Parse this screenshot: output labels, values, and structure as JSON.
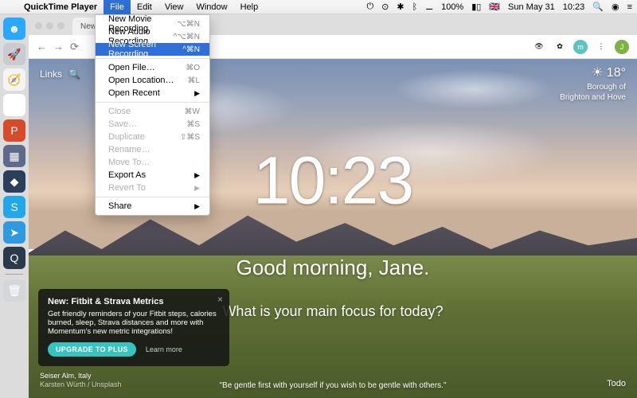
{
  "menubar": {
    "app_name": "QuickTime Player",
    "items": [
      "File",
      "Edit",
      "View",
      "Window",
      "Help"
    ],
    "active_index": 0,
    "right": {
      "battery": "100%",
      "date": "Sun May 31",
      "time": "10:23"
    }
  },
  "file_menu": {
    "groups": [
      [
        {
          "label": "New Movie Recording",
          "shortcut": "⌥⌘N"
        },
        {
          "label": "New Audio Recording",
          "shortcut": "^⌥⌘N"
        },
        {
          "label": "New Screen Recording",
          "shortcut": "^⌘N",
          "highlighted": true
        }
      ],
      [
        {
          "label": "Open File…",
          "shortcut": "⌘O"
        },
        {
          "label": "Open Location…",
          "shortcut": "⌘L"
        },
        {
          "label": "Open Recent",
          "submenu": true
        }
      ],
      [
        {
          "label": "Close",
          "shortcut": "⌘W",
          "disabled": true
        },
        {
          "label": "Save…",
          "shortcut": "⌘S",
          "disabled": true
        },
        {
          "label": "Duplicate",
          "shortcut": "⇧⌘S",
          "disabled": true
        },
        {
          "label": "Rename…",
          "disabled": true
        },
        {
          "label": "Move To…",
          "disabled": true
        },
        {
          "label": "Export As",
          "submenu": true
        },
        {
          "label": "Revert To",
          "submenu": true,
          "disabled": true
        }
      ],
      [
        {
          "label": "Share",
          "submenu": true
        }
      ]
    ]
  },
  "dock": [
    {
      "name": "finder",
      "color": "#2aa7ff",
      "glyph": "☻"
    },
    {
      "name": "launchpad",
      "color": "#c8ccd2",
      "glyph": "🚀"
    },
    {
      "name": "safari",
      "color": "#f2f4f8",
      "glyph": "🧭"
    },
    {
      "name": "chrome",
      "color": "#ffffff",
      "glyph": "◉"
    },
    {
      "name": "powerpoint",
      "color": "#d64b2a",
      "glyph": "P"
    },
    {
      "name": "app1",
      "color": "#5c6b8a",
      "glyph": "▦"
    },
    {
      "name": "steam",
      "color": "#2a3f5a",
      "glyph": "◆"
    },
    {
      "name": "skype",
      "color": "#22a7e8",
      "glyph": "S"
    },
    {
      "name": "telegram",
      "color": "#2f9ae0",
      "glyph": "➤"
    },
    {
      "name": "quicktime",
      "color": "#2b3a4a",
      "glyph": "Q"
    },
    {
      "name": "trash",
      "color": "#d4d6d9",
      "glyph": "🗑"
    }
  ],
  "browser": {
    "tab_title": "New Tab",
    "avatar_initial": "J"
  },
  "page": {
    "links_label": "Links",
    "weather": {
      "temp": "18°",
      "line1": "Borough of",
      "line2": "Brighton and Hove"
    },
    "clock": "10:23",
    "greeting": "Good morning, Jane.",
    "focus_prompt": "What is your main focus for today?",
    "quote": "\"Be gentle first with yourself if you wish to be gentle with others.\"",
    "location": {
      "place": "Seiser Alm, Italy",
      "credit": "Karsten Würth / Unsplash"
    },
    "todo_label": "Todo"
  },
  "promo": {
    "title": "New: Fitbit & Strava Metrics",
    "body": "Get friendly reminders of your Fitbit steps, calories burned, sleep, Strava distances and more with Momentum's new metric integrations!",
    "cta": "UPGRADE TO PLUS",
    "learn": "Learn more"
  }
}
